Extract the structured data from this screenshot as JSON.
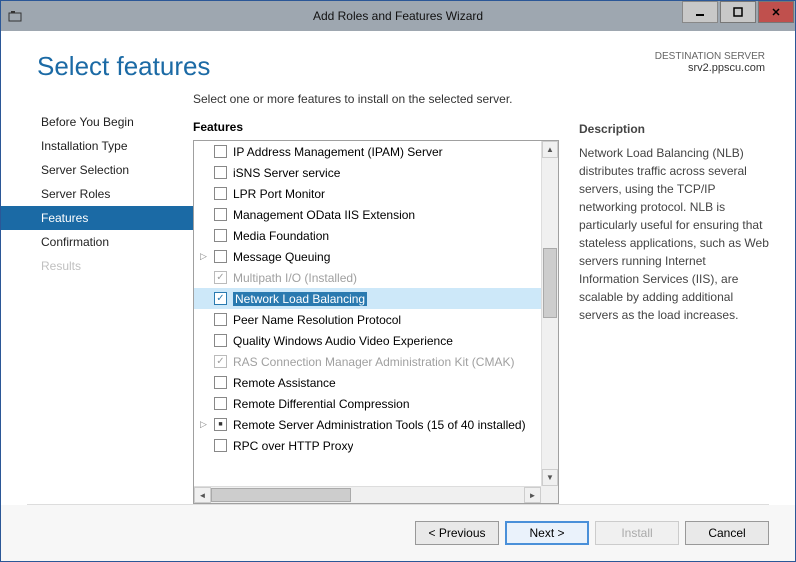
{
  "titlebar": {
    "title": "Add Roles and Features Wizard"
  },
  "header": {
    "page_title": "Select features",
    "dest_label": "DESTINATION SERVER",
    "dest_value": "srv2.ppscu.com"
  },
  "sidebar": {
    "items": [
      {
        "label": "Before You Begin",
        "state": "normal"
      },
      {
        "label": "Installation Type",
        "state": "normal"
      },
      {
        "label": "Server Selection",
        "state": "normal"
      },
      {
        "label": "Server Roles",
        "state": "normal"
      },
      {
        "label": "Features",
        "state": "selected"
      },
      {
        "label": "Confirmation",
        "state": "normal"
      },
      {
        "label": "Results",
        "state": "disabled"
      }
    ]
  },
  "main": {
    "instruction": "Select one or more features to install on the selected server.",
    "features_heading": "Features",
    "description_heading": "Description",
    "features": [
      {
        "label": "IP Address Management (IPAM) Server",
        "checked": false,
        "disabled": false,
        "expander": false,
        "tri": false,
        "selected": false
      },
      {
        "label": "iSNS Server service",
        "checked": false,
        "disabled": false,
        "expander": false,
        "tri": false,
        "selected": false
      },
      {
        "label": "LPR Port Monitor",
        "checked": false,
        "disabled": false,
        "expander": false,
        "tri": false,
        "selected": false
      },
      {
        "label": "Management OData IIS Extension",
        "checked": false,
        "disabled": false,
        "expander": false,
        "tri": false,
        "selected": false
      },
      {
        "label": "Media Foundation",
        "checked": false,
        "disabled": false,
        "expander": false,
        "tri": false,
        "selected": false
      },
      {
        "label": "Message Queuing",
        "checked": false,
        "disabled": false,
        "expander": true,
        "tri": false,
        "selected": false
      },
      {
        "label": "Multipath I/O (Installed)",
        "checked": true,
        "disabled": true,
        "expander": false,
        "tri": false,
        "selected": false
      },
      {
        "label": "Network Load Balancing",
        "checked": true,
        "disabled": false,
        "expander": false,
        "tri": false,
        "selected": true
      },
      {
        "label": "Peer Name Resolution Protocol",
        "checked": false,
        "disabled": false,
        "expander": false,
        "tri": false,
        "selected": false
      },
      {
        "label": "Quality Windows Audio Video Experience",
        "checked": false,
        "disabled": false,
        "expander": false,
        "tri": false,
        "selected": false
      },
      {
        "label": "RAS Connection Manager Administration Kit (CMAK)",
        "checked": true,
        "disabled": true,
        "expander": false,
        "tri": false,
        "selected": false
      },
      {
        "label": "Remote Assistance",
        "checked": false,
        "disabled": false,
        "expander": false,
        "tri": false,
        "selected": false
      },
      {
        "label": "Remote Differential Compression",
        "checked": false,
        "disabled": false,
        "expander": false,
        "tri": false,
        "selected": false
      },
      {
        "label": "Remote Server Administration Tools (15 of 40 installed)",
        "checked": false,
        "disabled": false,
        "expander": true,
        "tri": true,
        "selected": false
      },
      {
        "label": "RPC over HTTP Proxy",
        "checked": false,
        "disabled": false,
        "expander": false,
        "tri": false,
        "selected": false
      }
    ],
    "description_text": "Network Load Balancing (NLB) distributes traffic across several servers, using the TCP/IP networking protocol. NLB is particularly useful for ensuring that stateless applications, such as Web servers running Internet Information Services (IIS), are scalable by adding additional servers as the load increases."
  },
  "footer": {
    "previous": "< Previous",
    "next": "Next >",
    "install": "Install",
    "cancel": "Cancel"
  }
}
